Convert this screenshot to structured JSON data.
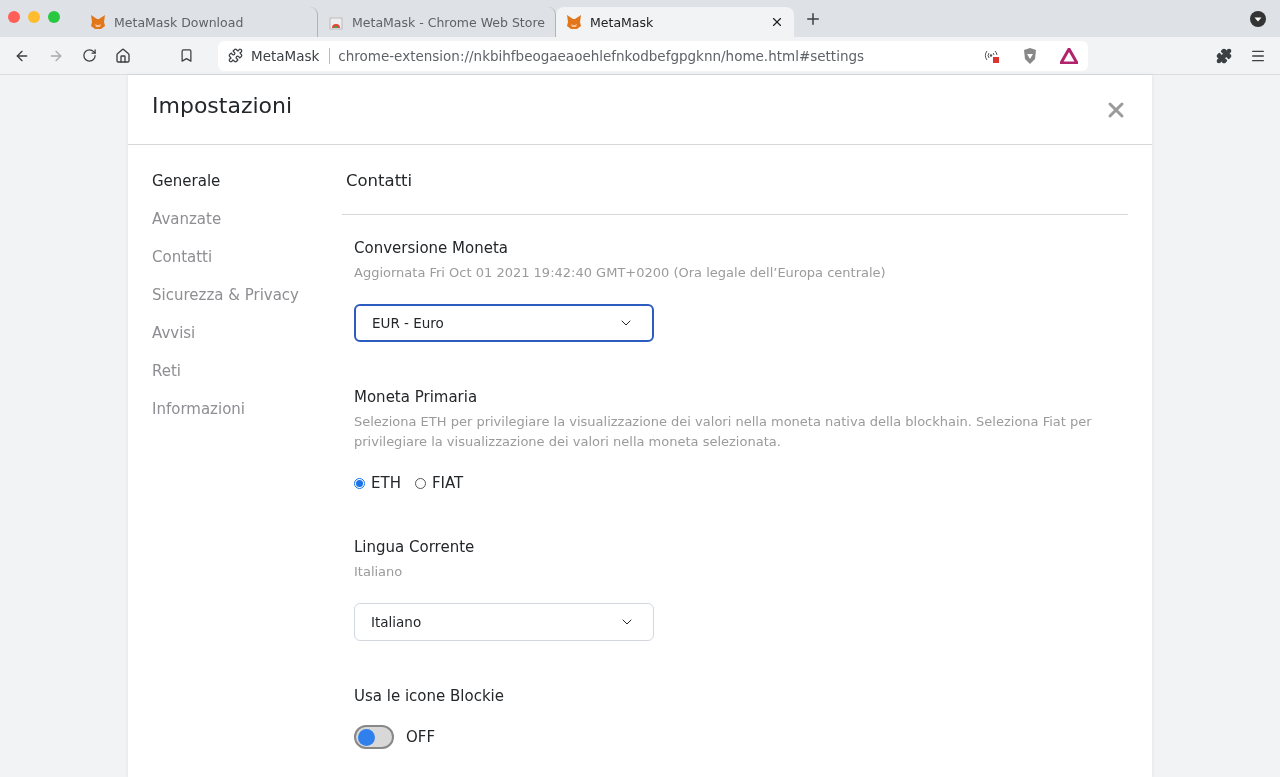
{
  "browser": {
    "tabs": [
      {
        "title": "MetaMask Download",
        "selected": false
      },
      {
        "title": "MetaMask - Chrome Web Store",
        "selected": false
      },
      {
        "title": "MetaMask",
        "selected": true
      }
    ],
    "address": {
      "site": "MetaMask",
      "url": "chrome-extension://nkbihfbeogaeaoehlefnkodbefgpgknn/home.html#settings"
    }
  },
  "settings": {
    "title": "Impostazioni",
    "sidebar": [
      {
        "label": "Generale",
        "selected": true
      },
      {
        "label": "Avanzate",
        "selected": false
      },
      {
        "label": "Contatti",
        "selected": false
      },
      {
        "label": "Sicurezza & Privacy",
        "selected": false
      },
      {
        "label": "Avvisi",
        "selected": false
      },
      {
        "label": "Reti",
        "selected": false
      },
      {
        "label": "Informazioni",
        "selected": false
      }
    ],
    "section_title": "Contatti",
    "items": [
      {
        "kind": "select",
        "title": "Conversione Moneta",
        "description": "Aggiornata Fri Oct 01 2021 19:42:40 GMT+0200 (Ora legale dell’Europa centrale)",
        "value": "EUR - Euro",
        "focused": true
      },
      {
        "kind": "radio",
        "title": "Moneta Primaria",
        "description": "Seleziona ETH per privilegiare la visualizzazione dei valori nella moneta nativa della blockhain. Seleziona Fiat per privilegiare la visualizzazione dei valori nella moneta selezionata.",
        "options": [
          {
            "label": "ETH",
            "selected": true
          },
          {
            "label": "FIAT",
            "selected": false
          }
        ]
      },
      {
        "kind": "select",
        "title": "Lingua Corrente",
        "description": "Italiano",
        "value": "Italiano",
        "focused": false
      },
      {
        "kind": "toggle",
        "title": "Usa le icone Blockie",
        "on": false,
        "state_label": "OFF"
      }
    ]
  }
}
